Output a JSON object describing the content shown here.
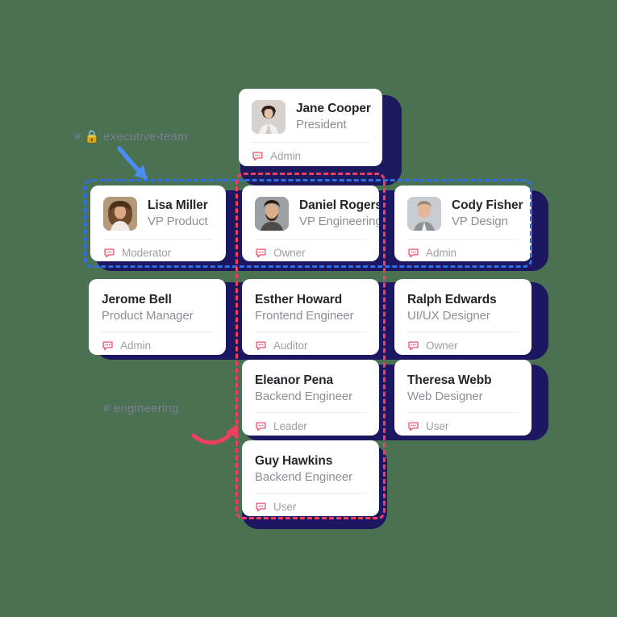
{
  "canvas": {
    "background_color": "#4a7152",
    "shadow_color": "#1c1760"
  },
  "annotations": [
    {
      "id": "executive-team",
      "text": "# 🔒 executive-team",
      "arrow_color": "#4a8cf0",
      "text_color": "#7b7f93"
    },
    {
      "id": "engineering",
      "text": "# engineering",
      "arrow_color": "#ef4060",
      "text_color": "#7b7f93"
    }
  ],
  "frames": [
    {
      "id": "executive-team-frame",
      "color": "#2f6fe4",
      "style": "dashed"
    },
    {
      "id": "engineering-frame",
      "color": "#ef4060",
      "style": "dashed"
    }
  ],
  "tag_icon": {
    "name": "chat-bubble-icon",
    "color": "#ef4f6b"
  },
  "cards": [
    {
      "id": "jane-cooper",
      "name": "Jane Cooper",
      "role": "President",
      "tag": "Admin",
      "has_avatar": true,
      "avatar_name": "avatar-jane-cooper"
    },
    {
      "id": "lisa-miller",
      "name": "Lisa Miller",
      "role": "VP Product",
      "tag": "Moderator",
      "has_avatar": true,
      "avatar_name": "avatar-lisa-miller"
    },
    {
      "id": "daniel-rogers",
      "name": "Daniel Rogers",
      "role": "VP Engineering",
      "tag": "Owner",
      "has_avatar": true,
      "avatar_name": "avatar-daniel-rogers"
    },
    {
      "id": "cody-fisher",
      "name": "Cody Fisher",
      "role": "VP Design",
      "tag": "Admin",
      "has_avatar": true,
      "avatar_name": "avatar-cody-fisher"
    },
    {
      "id": "jerome-bell",
      "name": "Jerome Bell",
      "role": "Product Manager",
      "tag": "Admin",
      "has_avatar": false
    },
    {
      "id": "esther-howard",
      "name": "Esther Howard",
      "role": "Frontend Engineer",
      "tag": "Auditor",
      "has_avatar": false
    },
    {
      "id": "ralph-edwards",
      "name": "Ralph Edwards",
      "role": "UI/UX Designer",
      "tag": "Owner",
      "has_avatar": false
    },
    {
      "id": "eleanor-pena",
      "name": "Eleanor Pena",
      "role": "Backend Engineer",
      "tag": "Leader",
      "has_avatar": false
    },
    {
      "id": "theresa-webb",
      "name": "Theresa Webb",
      "role": "Web Designer",
      "tag": "User",
      "has_avatar": false
    },
    {
      "id": "guy-hawkins",
      "name": "Guy Hawkins",
      "role": "Backend Engineer",
      "tag": "User",
      "has_avatar": false
    }
  ]
}
